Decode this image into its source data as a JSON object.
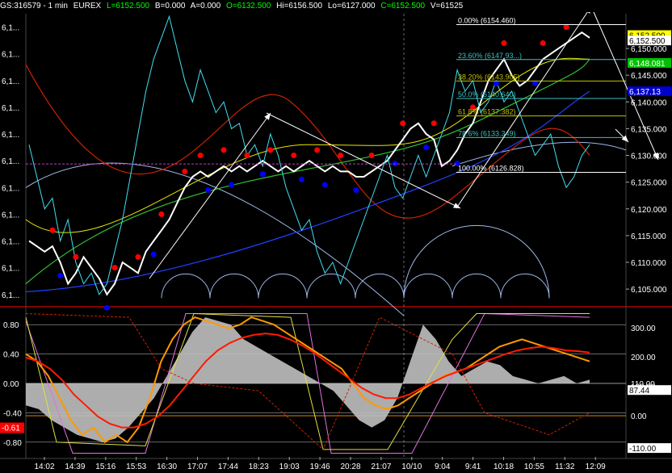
{
  "header": {
    "symbol": "GS:316579 - 1 min",
    "exchange": "EUREX",
    "last_label": "L=6152.500",
    "bid_label": "B=0.000",
    "ask_label": "A=0.000",
    "open_label": "O=6132.500",
    "high_label": "Hi=6156.500",
    "low_label": "Lo=6127.000",
    "close_label": "C=6152.500",
    "volume_label": "V=61525"
  },
  "colors": {
    "background": "#000000",
    "panel_border": "#ff0000",
    "price": "#ffffff",
    "cyan": "#40e0f0",
    "red_marker": "#ff0000",
    "blue_marker": "#0000ff",
    "ema_red": "#cc2200",
    "ema_yellow": "#e8e800",
    "ema_green": "#30c030",
    "ema_blue": "#2040ff",
    "arc": "#9fb7e8",
    "osc_orange": "#ff9900",
    "osc_yellow": "#ffff40",
    "osc_red": "#ff1a00",
    "osc_gray": "#c0c0c0",
    "osc_magenta": "#e070e0",
    "label_green": "#00c000",
    "label_yellow": "#ffff00",
    "label_blue": "#0000cc"
  },
  "chart_data": [
    {
      "type": "line",
      "panel": "price",
      "left_labels": [
        "6,1...",
        "6,1...",
        "6,1...",
        "6,1...",
        "6,1...",
        "6,1...",
        "6,1...",
        "6,1...",
        "6,1...",
        "6,1...",
        "6,1..."
      ],
      "y_ticks": [
        "6,150.000",
        "6,145.000",
        "6,140.000",
        "6,135.000",
        "6,130.000",
        "6,125.000",
        "6,120.000",
        "6,115.000",
        "6,110.000",
        "6,105.000"
      ],
      "y_tick_values": [
        6150,
        6145,
        6140,
        6135,
        6130,
        6125,
        6120,
        6115,
        6110,
        6105
      ],
      "ylim": [
        6102,
        6156.5
      ],
      "value_labels": [
        {
          "text": "6,152.500",
          "value": 6152.5,
          "style": "yellow"
        },
        {
          "text": "6,152.500",
          "value": 6151.5,
          "style": "white"
        },
        {
          "text": "6,148.081",
          "value": 6147.3,
          "style": "green"
        },
        {
          "text": "6,137.13",
          "value": 6142.0,
          "style": "blue"
        }
      ],
      "fib_levels": [
        {
          "label": "0.00% (6154.460)",
          "value": 6154.46
        },
        {
          "label": "23.60% (6147.93...)",
          "value": 6147.93
        },
        {
          "label": "38.20% (6143.905)",
          "value": 6143.905
        },
        {
          "label": "50.0% (6140.640)",
          "value": 6140.64
        },
        {
          "label": "61.8% (6137.382)",
          "value": 6137.382
        },
        {
          "label": "78.6% (6133.349)",
          "value": 6133.349
        },
        {
          "label": "100.00% (6126.828)",
          "value": 6126.828
        }
      ],
      "series": [
        {
          "name": "",
          "color": "price",
          "values": [
            6114,
            6113,
            6112,
            6113,
            6110,
            6106,
            6108,
            6111,
            6109,
            6107,
            6104,
            6106,
            6110,
            6109,
            6108,
            6112,
            6114,
            6116,
            6118,
            6121,
            6124,
            6126,
            6127,
            6126,
            6127,
            6128,
            6127,
            6128,
            6127,
            6128,
            6129,
            6128,
            6127,
            6128,
            6127,
            6128,
            6129,
            6128,
            6127,
            6128,
            6127,
            6127,
            6126,
            6126,
            6127,
            6128,
            6129,
            6131,
            6133,
            6135,
            6136,
            6134,
            6133,
            6128,
            6129,
            6131,
            6134,
            6136,
            6140,
            6144,
            6146,
            6148,
            6145,
            6143,
            6144,
            6146,
            6148,
            6149,
            6150,
            6151,
            6152,
            6153,
            6152
          ]
        },
        {
          "name": "",
          "color": "cyan",
          "values": [
            6132,
            6126,
            6120,
            6122,
            6114,
            6118,
            6110,
            6106,
            6108,
            6104,
            6106,
            6112,
            6118,
            6126,
            6134,
            6142,
            6148,
            6152,
            6156,
            6150,
            6144,
            6140,
            6146,
            6142,
            6138,
            6140,
            6135,
            6136,
            6130,
            6132,
            6128,
            6134,
            6130,
            6124,
            6120,
            6116,
            6118,
            6112,
            6108,
            6110,
            6106,
            6110,
            6114,
            6118,
            6122,
            6126,
            6130,
            6124,
            6122,
            6126,
            6130,
            6126,
            6130,
            6134,
            6138,
            6146,
            6142,
            6144,
            6138,
            6140,
            6144,
            6140,
            6142,
            6138,
            6134,
            6130,
            6132,
            6134,
            6128,
            6124,
            6126,
            6130,
            6132
          ]
        }
      ],
      "annotations": [
        "fibonacci retracement",
        "trend arrows",
        "cycle arcs"
      ]
    },
    {
      "type": "line",
      "panel": "oscillator",
      "y_left_ticks": [
        "0.80",
        "0.40",
        "0.00",
        "-0.40",
        "-0.80"
      ],
      "y_left_values": [
        0.8,
        0.4,
        0.0,
        -0.4,
        -0.8
      ],
      "ylim_left": [
        -1.0,
        1.0
      ],
      "left_marker": {
        "text": "-0.61",
        "value": -0.61
      },
      "y_right_ticks": [
        "300.00",
        "200.00",
        "100.00",
        "0.00"
      ],
      "y_right_values": [
        300,
        200,
        100,
        0
      ],
      "ylim_right": [
        -140,
        360
      ],
      "right_value_labels": [
        {
          "text": "110.00",
          "value": 110,
          "style": "white"
        },
        {
          "text": "87.44",
          "value": 87.44,
          "style": "box"
        },
        {
          "text": "-110.00",
          "value": -110,
          "style": "box"
        }
      ],
      "series": [
        {
          "name": "",
          "color": "osc_orange",
          "values": [
            0.4,
            0.3,
            0.1,
            -0.2,
            -0.5,
            -0.7,
            -0.6,
            -0.8,
            -0.7,
            -0.8,
            -0.6,
            -0.2,
            0.3,
            0.6,
            0.8,
            0.9,
            0.85,
            0.8,
            0.75,
            0.8,
            0.9,
            0.85,
            0.8,
            0.7,
            0.6,
            0.5,
            0.4,
            0.3,
            0.2,
            0.0,
            -0.2,
            -0.3,
            -0.35,
            -0.3,
            -0.2,
            -0.1,
            0.0,
            0.1,
            0.15,
            0.2,
            0.3,
            0.4,
            0.5,
            0.55,
            0.6,
            0.55,
            0.5,
            0.45,
            0.4,
            0.35,
            0.3
          ]
        },
        {
          "name": "",
          "color": "osc_red",
          "values": [
            0.35,
            0.3,
            0.2,
            0.05,
            -0.15,
            -0.3,
            -0.45,
            -0.55,
            -0.6,
            -0.6,
            -0.55,
            -0.45,
            -0.3,
            -0.1,
            0.1,
            0.3,
            0.45,
            0.55,
            0.62,
            0.66,
            0.68,
            0.66,
            0.6,
            0.52,
            0.42,
            0.3,
            0.18,
            0.06,
            -0.06,
            -0.15,
            -0.2,
            -0.2,
            -0.15,
            -0.06,
            0.02,
            0.1,
            0.16,
            0.22,
            0.28,
            0.34,
            0.4,
            0.45,
            0.48,
            0.5,
            0.48,
            0.45,
            0.44,
            0.42
          ]
        },
        {
          "name": "",
          "color": "osc_gray",
          "values": [
            -0.3,
            -0.35,
            -0.5,
            -0.6,
            -0.7,
            -0.75,
            -0.8,
            -0.75,
            -0.6,
            -0.4,
            -0.2,
            0.1,
            0.4,
            0.7,
            0.9,
            0.85,
            0.8,
            0.6,
            0.5,
            0.4,
            0.3,
            0.2,
            0.1,
            0.0,
            -0.1,
            -0.3,
            -0.5,
            -0.6,
            -0.5,
            -0.2,
            0.3,
            0.8,
            0.6,
            0.3,
            0.1,
            0.2,
            0.3,
            0.25,
            0.1,
            0.05,
            0.0,
            0.05,
            0.1,
            0.0,
            0.05
          ]
        }
      ]
    }
  ],
  "x_axis": {
    "labels": [
      "14:02",
      "14:39",
      "15:16",
      "15:53",
      "16:30",
      "17:07",
      "17:44",
      "18:23",
      "19:03",
      "19:46",
      "20:28",
      "21:07",
      "10/10",
      "9:04",
      "9:41",
      "10:18",
      "10:55",
      "11:32",
      "12:09"
    ]
  }
}
